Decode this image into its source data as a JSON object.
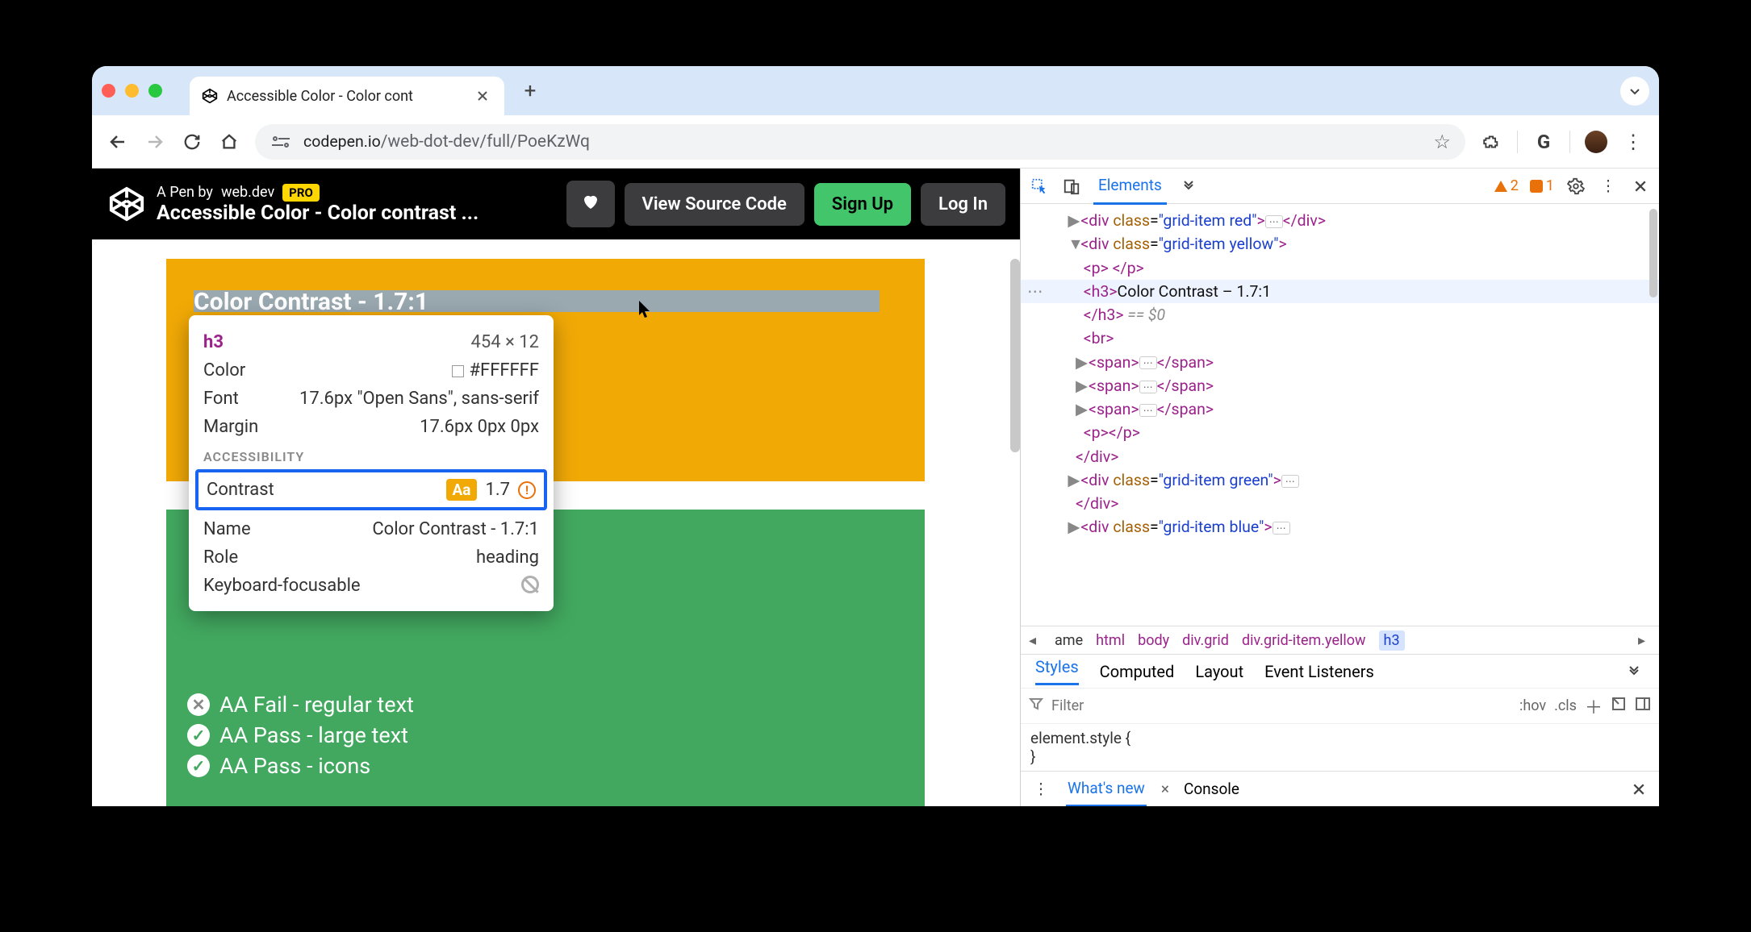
{
  "browser": {
    "tab_title": "Accessible Color - Color cont",
    "url_domain": "codepen.io",
    "url_path": "/web-dot-dev/full/PoeKzWq"
  },
  "codepen": {
    "byline_prefix": "A Pen by ",
    "byline_author": "web.dev",
    "pro_badge": "PRO",
    "pen_name": "Accessible Color - Color contrast ...",
    "view_source": "View Source Code",
    "sign_up": "Sign Up",
    "log_in": "Log In"
  },
  "page": {
    "heading_highlight": "Color Contrast - 1.7:1",
    "results": [
      {
        "pass": false,
        "label": "AA Fail - regular text"
      },
      {
        "pass": true,
        "label": "AA Pass - large text"
      },
      {
        "pass": true,
        "label": "AA Pass - icons"
      }
    ]
  },
  "tooltip": {
    "tag": "h3",
    "dimensions": "454 × 12",
    "rows": [
      {
        "k": "Color",
        "v": "#FFFFFF",
        "swatch": "#ffffff"
      },
      {
        "k": "Font",
        "v": "17.6px \"Open Sans\", sans-serif"
      },
      {
        "k": "Margin",
        "v": "17.6px 0px 0px"
      }
    ],
    "section": "ACCESSIBILITY",
    "contrast_label": "Contrast",
    "contrast_value": "1.7",
    "contrast_badge": "Aa",
    "name_label": "Name",
    "name_value": "Color Contrast - 1.7:1",
    "role_label": "Role",
    "role_value": "heading",
    "focus_label": "Keyboard-focusable"
  },
  "devtools": {
    "tab_elements": "Elements",
    "warnings": "2",
    "errors": "1",
    "dom": {
      "l1": "<div class=\"grid-item red\">",
      "l2": "<div class=\"grid-item yellow\">",
      "l3": "<p> </p>",
      "l4_open": "<h3>",
      "l4_text": "Color Contrast – 1.7:1",
      "l5": "</h3>",
      "l5_eq": " == $0",
      "l6": "<br>",
      "l7": "<span>",
      "l7c": "</span>",
      "l10": "<p></p>",
      "l11": "</div>",
      "l12": "<div class=\"grid-item green\">",
      "l13": "</div>",
      "l14": "<div class=\"grid-item blue\">"
    },
    "crumb": [
      "ame",
      "html",
      "body",
      "div.grid",
      "div.grid-item.yellow",
      "h3"
    ],
    "styles_tabs": [
      "Styles",
      "Computed",
      "Layout",
      "Event Listeners"
    ],
    "filter_placeholder": "Filter",
    "hov": ":hov",
    "cls": ".cls",
    "element_style": "element.style {",
    "brace": "}",
    "drawer_whatsnew": "What's new",
    "drawer_console": "Console"
  }
}
